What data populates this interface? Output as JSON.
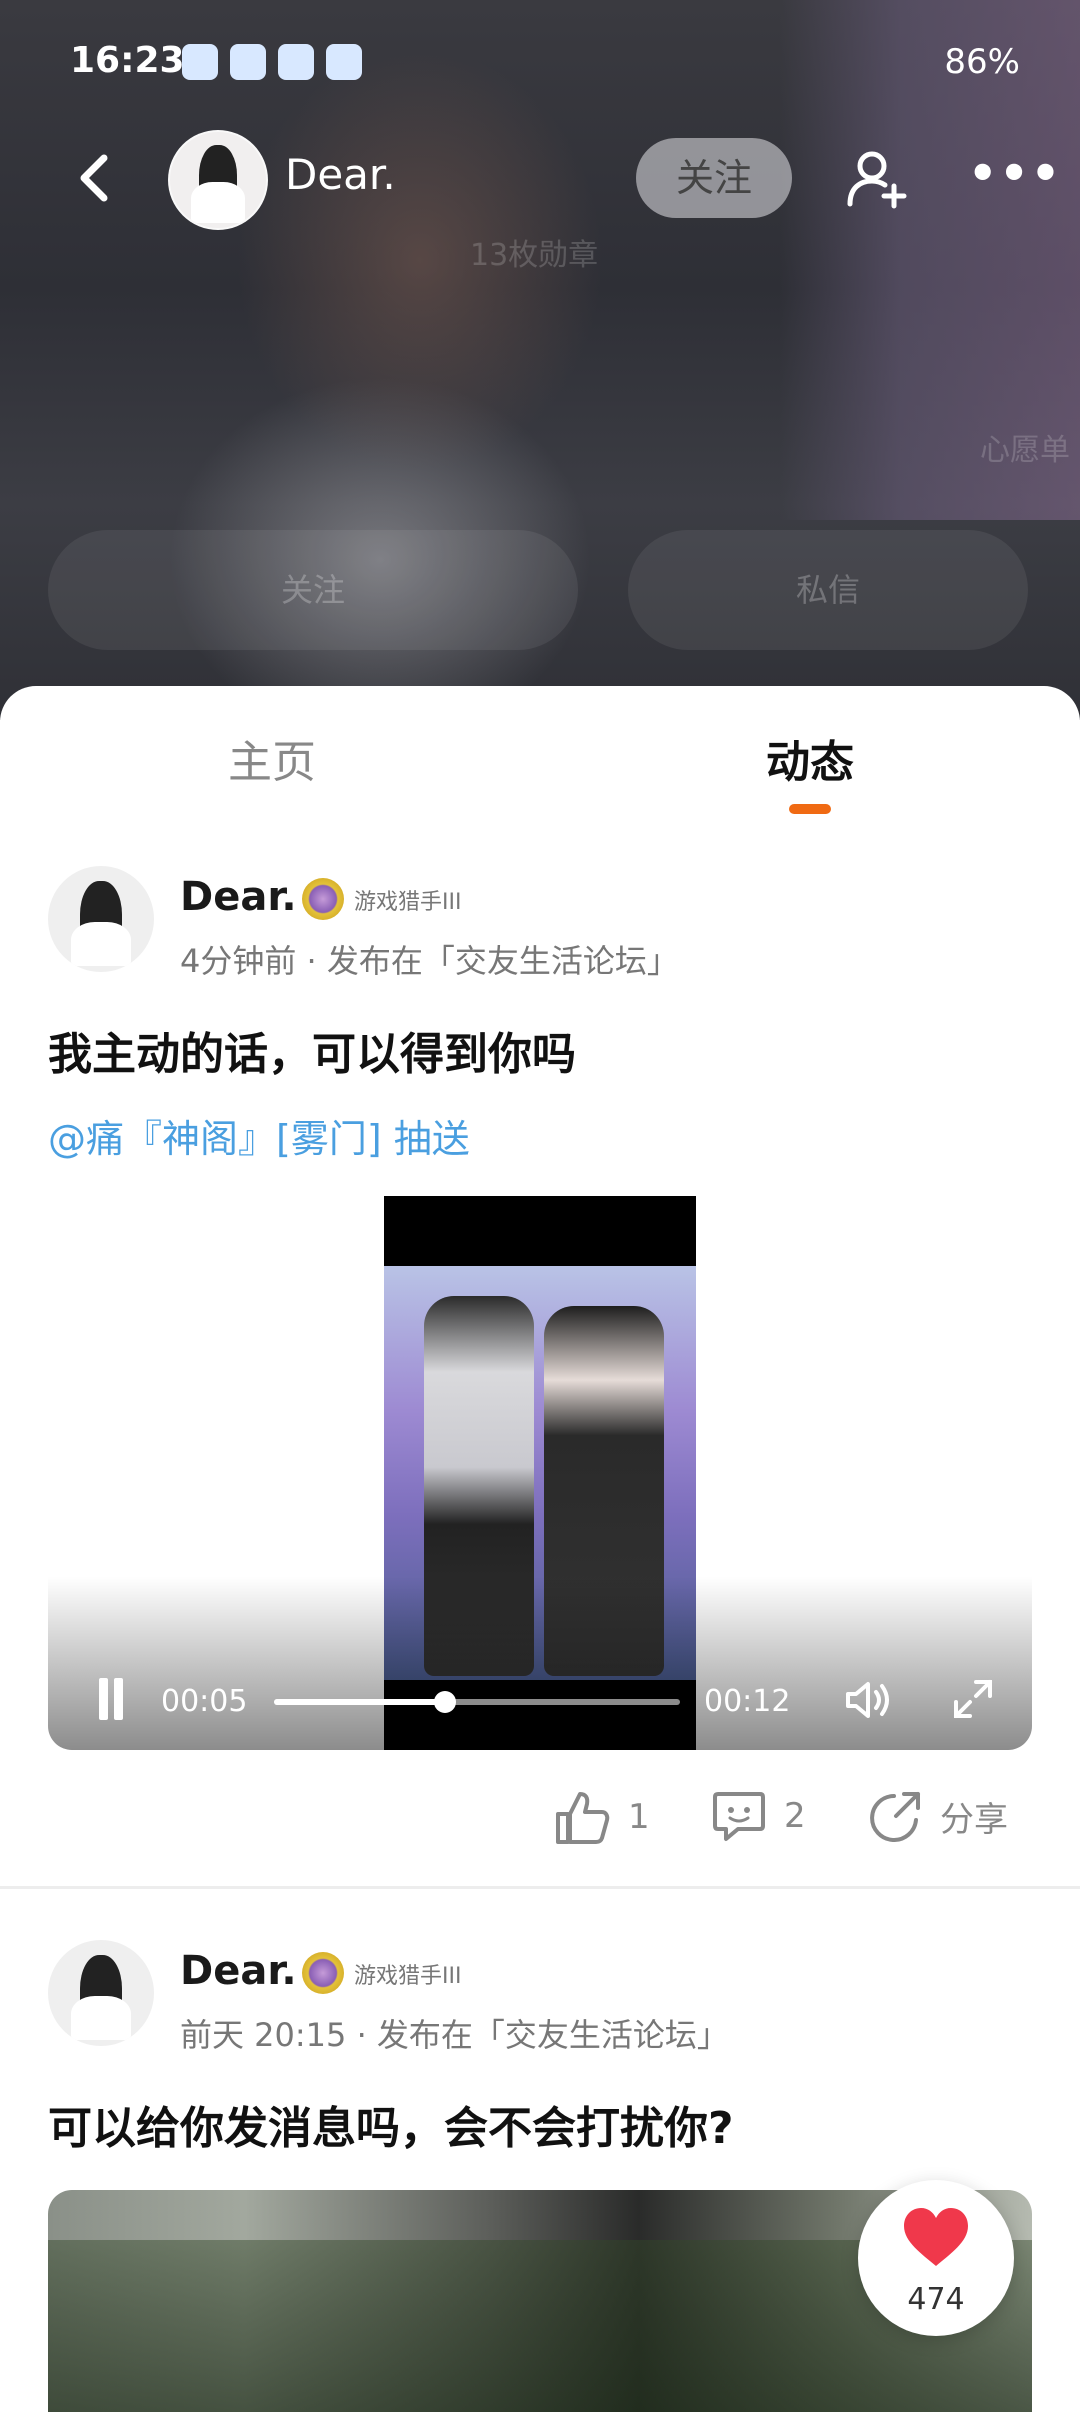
{
  "status_bar": {
    "time": "16:23",
    "battery": "86%"
  },
  "header": {
    "back_icon": "chevron-left-icon",
    "username": "Dear.",
    "follow_label": "关注",
    "add_friend_icon": "add-user-icon",
    "more_icon": "more-dots-icon",
    "background_buttons": {
      "follow": "关注",
      "message": "私信"
    },
    "background_text": {
      "medals": "13枚勋章",
      "wishlist": "心愿单"
    }
  },
  "tabs": [
    {
      "label": "主页",
      "active": false
    },
    {
      "label": "动态",
      "active": true
    }
  ],
  "accent_color": "#f06a13",
  "posts": [
    {
      "author": "Dear.",
      "badge_text": "游戏猎手III",
      "meta": "4分钟前 · 发布在「交友生活论坛」",
      "text": "我主动的话，可以得到你吗",
      "mention": "@痛『神阁』[雾门] 抽送",
      "video": {
        "current_time": "00:05",
        "duration": "00:12",
        "progress": 0.42
      },
      "actions": {
        "like_count": "1",
        "comment_count": "2",
        "share_label": "分享"
      }
    },
    {
      "author": "Dear.",
      "badge_text": "游戏猎手III",
      "meta": "前天 20:15 · 发布在「交友生活论坛」",
      "text": "可以给你发消息吗，会不会打扰你?"
    }
  ],
  "like_fab": {
    "count": "474",
    "color": "#f0384b"
  }
}
